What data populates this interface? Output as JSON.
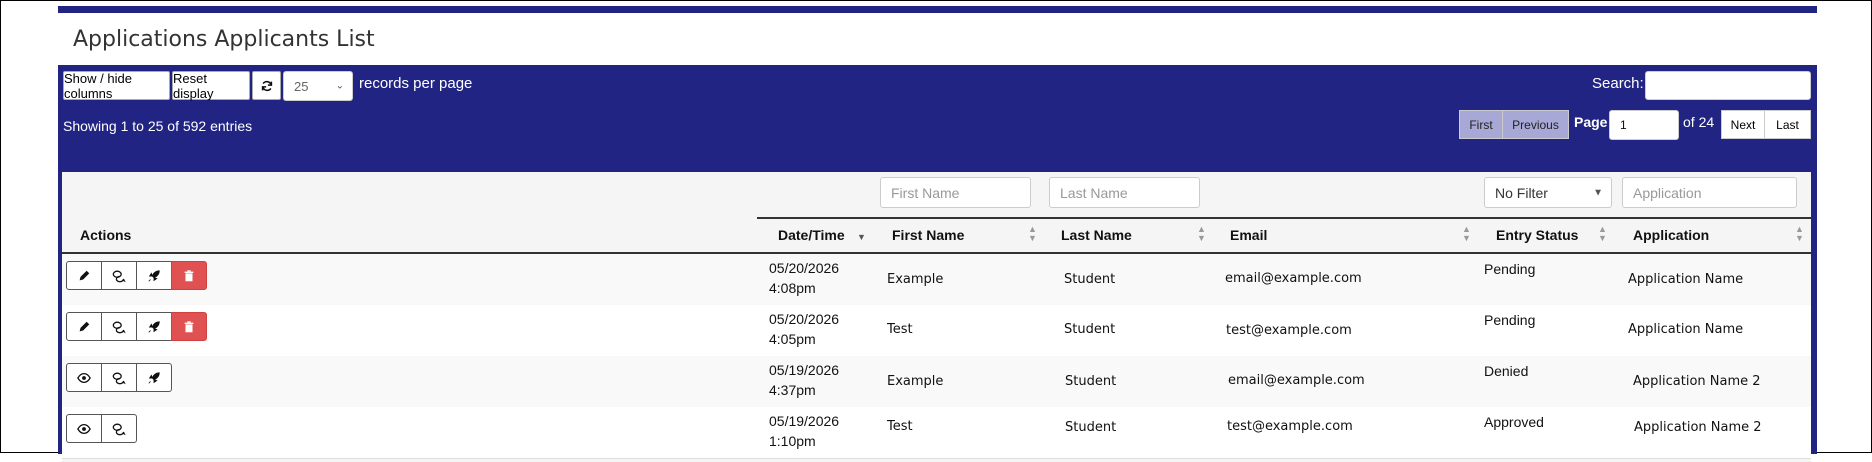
{
  "page": {
    "title": "Applications Applicants List"
  },
  "toolbar": {
    "show_hide_label": "Show / hide columns",
    "reset_label": "Reset display",
    "per_page_value": "25",
    "per_page_suffix": "records per page",
    "search_label": "Search:",
    "search_value": ""
  },
  "info": {
    "text": "Showing 1 to 25 of 592 entries"
  },
  "pagination": {
    "first_label": "First",
    "previous_label": "Previous",
    "page_label": "Page",
    "page_value": "1",
    "of_label": "of 24",
    "next_label": "Next",
    "last_label": "Last"
  },
  "filters": {
    "first_name_placeholder": "First Name",
    "last_name_placeholder": "Last Name",
    "entry_status_value": "No Filter",
    "application_placeholder": "Application"
  },
  "columns": {
    "actions": "Actions",
    "date_time": "Date/Time",
    "first_name": "First Name",
    "last_name": "Last Name",
    "email": "Email",
    "entry_status": "Entry Status",
    "application": "Application"
  },
  "rows": [
    {
      "date": "05/20/2026",
      "time": "4:08pm",
      "first_name": "Example",
      "last_name": "Student",
      "email": "email@example.com",
      "status": "Pending",
      "application": "Application Name"
    },
    {
      "date": "05/20/2026",
      "time": "4:05pm",
      "first_name": "Test",
      "last_name": "Student",
      "email": "test@example.com",
      "status": "Pending",
      "application": "Application Name"
    },
    {
      "date": "05/19/2026",
      "time": "4:37pm",
      "first_name": "Example",
      "last_name": "Student",
      "email": "email@example.com",
      "status": "Denied",
      "application": "Application Name 2"
    },
    {
      "date": "05/19/2026",
      "time": "1:10pm",
      "first_name": "Test",
      "last_name": "Student",
      "email": "test@example.com",
      "status": "Approved",
      "application": "Application Name 2"
    }
  ],
  "colors": {
    "panel": "#222483",
    "delete": "#e05252",
    "disabled_pager": "#a7a8d6"
  }
}
